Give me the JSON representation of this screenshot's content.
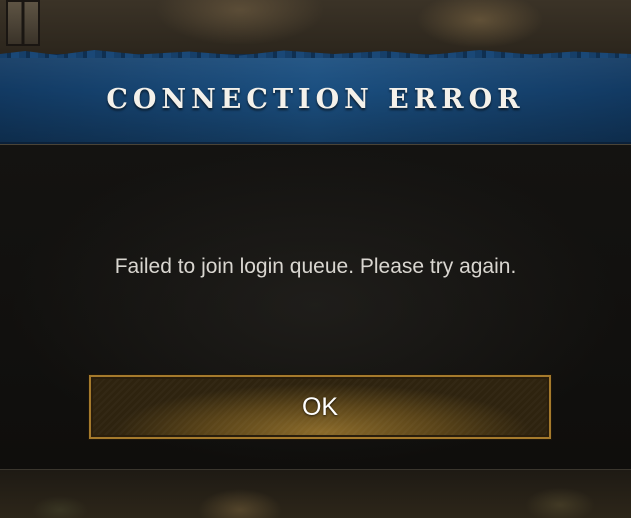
{
  "dialog": {
    "title": "CONNECTION ERROR",
    "message": "Failed to join login queue. Please try again.",
    "ok_label": "OK"
  },
  "colors": {
    "banner": "#1b4f80",
    "panel": "#121110",
    "button_border": "#a57a2c",
    "button_fill": "#5a4419",
    "title_text": "#f4f1ea",
    "message_text": "#d9d6d0"
  },
  "icons": {
    "background_lantern": "lantern-icon"
  }
}
